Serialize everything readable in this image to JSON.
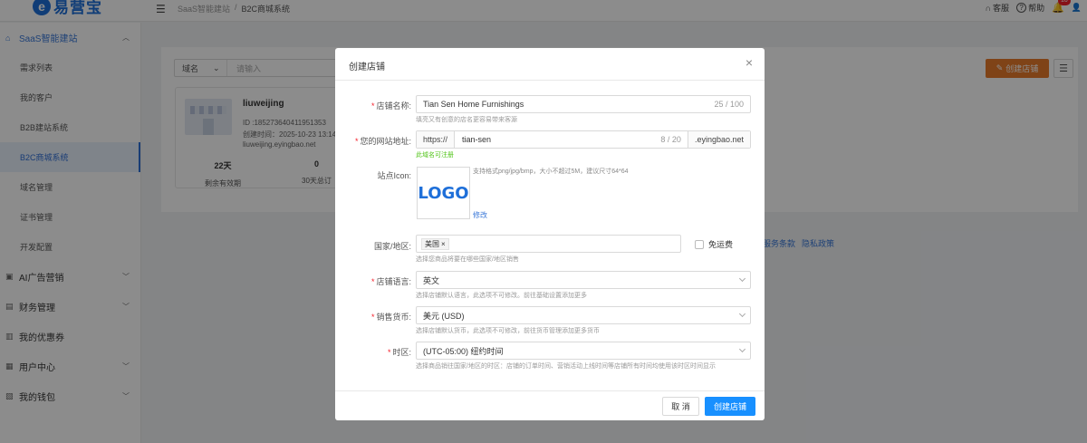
{
  "topbar": {
    "logo_mark": "e",
    "logo_text": "易营宝",
    "breadcrumb": [
      "SaaS智能建站",
      "/",
      "B2C商城系统"
    ],
    "service": "客服",
    "help": "帮助",
    "notification_count": "10"
  },
  "sidebar": {
    "groups": [
      {
        "label": "SaaS智能建站",
        "icon": "home-icon"
      },
      {
        "label": "AI广告营销",
        "icon": "ad-icon"
      },
      {
        "label": "财务管理",
        "icon": "finance-icon"
      },
      {
        "label": "我的优惠券",
        "icon": "coupon-icon"
      },
      {
        "label": "用户中心",
        "icon": "user-icon"
      },
      {
        "label": "我的钱包",
        "icon": "wallet-icon"
      }
    ],
    "items": [
      "需求列表",
      "我的客户",
      "B2B建站系统",
      "B2C商城系统",
      "域名管理",
      "证书管理",
      "开发配置"
    ]
  },
  "main": {
    "filter_select": "域名",
    "filter_placeholder": "请输入",
    "create_button": "创建店铺",
    "card": {
      "name": "liuweijing",
      "id": "ID :185273640411951353",
      "created": "创建时间：2025-10-23 13:14",
      "domain": "liuweijing.eyingbao.net",
      "stat1_value": "22天",
      "stat1_label": "剩余有效期",
      "stat2_value": "0",
      "stat2_label": "30天总订"
    },
    "legal_links": [
      "服务条款",
      "隐私政策"
    ]
  },
  "modal": {
    "title": "创建店铺",
    "store_name_label": "店铺名称:",
    "store_name_value": "Tian Sen Home Furnishings",
    "store_name_count": "25 / 100",
    "store_name_hint": "填亮又有创意的店名更容易带来客源",
    "url_label": "您的网站地址:",
    "url_prefix": "https://",
    "url_value": "tian-sen",
    "url_count": "8 / 20",
    "url_suffix": ".eyingbao.net",
    "url_hint": "此域名可注册",
    "icon_label": "站点Icon:",
    "icon_logo_text": "LOGO",
    "icon_hint": "支持格式png/jpg/bmp，大小不超过5M，建议尺寸64*64",
    "icon_edit": "修改",
    "country_label": "国家/地区:",
    "country_tag": "美国",
    "country_hint": "选择您商品将要在哪些国家/地区销售",
    "free_shipping": "免运费",
    "language_label": "店铺语言:",
    "language_value": "英文",
    "language_hint": "选择店铺默认语言，此选项不可修改。前往基础设置添加更多",
    "currency_label": "销售货币:",
    "currency_value": "美元 (USD)",
    "currency_hint": "选择店铺默认货币，此选项不可修改，前往货币管理添加更多货币",
    "timezone_label": "时区:",
    "timezone_value": "(UTC-05:00) 纽约时间",
    "timezone_hint": "选择商品销往国家/地区的时区：店铺的订单时间、营销活动上线时间等店铺所有时间均使用该时区时间显示",
    "cancel": "取 消",
    "confirm": "创建店铺"
  }
}
